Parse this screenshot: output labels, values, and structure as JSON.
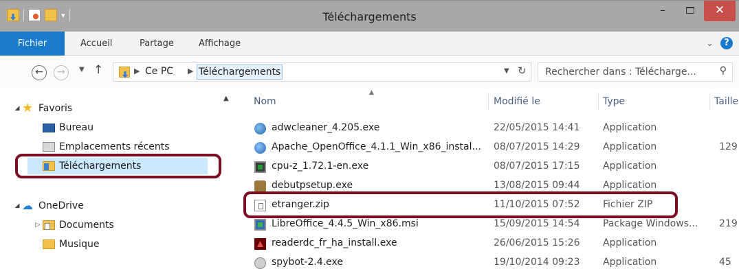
{
  "window": {
    "title": "Téléchargements",
    "minimize": "–",
    "close": "✕"
  },
  "ribbon": {
    "tabs": [
      "Fichier",
      "Accueil",
      "Partage",
      "Affichage"
    ],
    "expand": "⌄",
    "help": "?"
  },
  "address": {
    "back": "←",
    "forward": "→",
    "up": "↑",
    "crumbs": [
      "Ce PC",
      "Téléchargements"
    ],
    "refresh": "↻",
    "search_placeholder": "Rechercher dans : Télécharge..."
  },
  "nav": {
    "favorites": "Favoris",
    "items": [
      "Bureau",
      "Emplacements récents",
      "Téléchargements"
    ],
    "onedrive": "OneDrive",
    "onedrive_items": [
      "Documents",
      "Musique"
    ]
  },
  "columns": {
    "name": "Nom",
    "modified": "Modifié le",
    "type": "Type",
    "size": "Taille"
  },
  "files": [
    {
      "name": "adwcleaner_4.205.exe",
      "date": "22/05/2015 14:41",
      "type": "Application",
      "size": "",
      "icon": "adwcleaner-icon"
    },
    {
      "name": "Apache_OpenOffice_4.1.1_Win_x86_instal...",
      "date": "08/07/2015 14:29",
      "type": "Application",
      "size": "129",
      "icon": "openoffice-icon"
    },
    {
      "name": "cpu-z_1.72.1-en.exe",
      "date": "08/07/2015 17:15",
      "type": "Application",
      "size": "",
      "icon": "cpuz-icon"
    },
    {
      "name": "debutpsetup.exe",
      "date": "13/08/2015 09:44",
      "type": "Application",
      "size": "",
      "icon": "debut-icon"
    },
    {
      "name": "etranger.zip",
      "date": "11/10/2015 07:52",
      "type": "Fichier ZIP",
      "size": "",
      "icon": "zip-icon"
    },
    {
      "name": "LibreOffice_4.4.5_Win_x86.msi",
      "date": "15/09/2015 14:54",
      "type": "Package Windows...",
      "size": "219",
      "icon": "msi-icon"
    },
    {
      "name": "readerdc_fr_ha_install.exe",
      "date": "26/06/2015 15:26",
      "type": "Application",
      "size": "",
      "icon": "adobe-reader-icon"
    },
    {
      "name": "spybot-2.4.exe",
      "date": "19/10/2014 09:23",
      "type": "Application",
      "size": "45",
      "icon": "spybot-icon"
    }
  ],
  "colors": {
    "file_tab": "#1979ca",
    "close_button": "#c7504b",
    "selection": "#cce8ff",
    "highlight": "#7a0f22"
  }
}
